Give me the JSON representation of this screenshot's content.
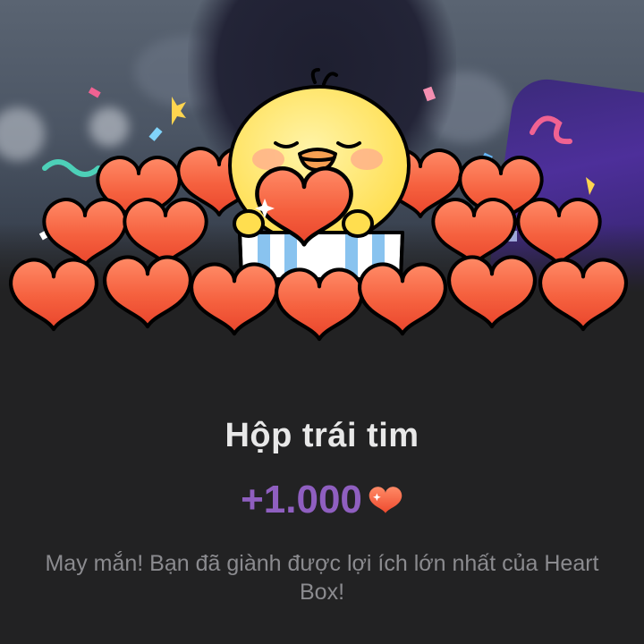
{
  "reward": {
    "title": "Hộp trái tim",
    "amount": "+1.000",
    "description": "May mắn! Bạn đã giành được lợi ích lớn nhất của Heart Box!"
  },
  "icons": {
    "amount_icon": "heart-icon",
    "mascot": "yellow-chick-holding-heart"
  },
  "colors": {
    "background": "#222223",
    "title": "#e8e8e8",
    "amount": "#8f5fc0",
    "description": "#8b8b8f",
    "heart": "#f25a3a"
  }
}
